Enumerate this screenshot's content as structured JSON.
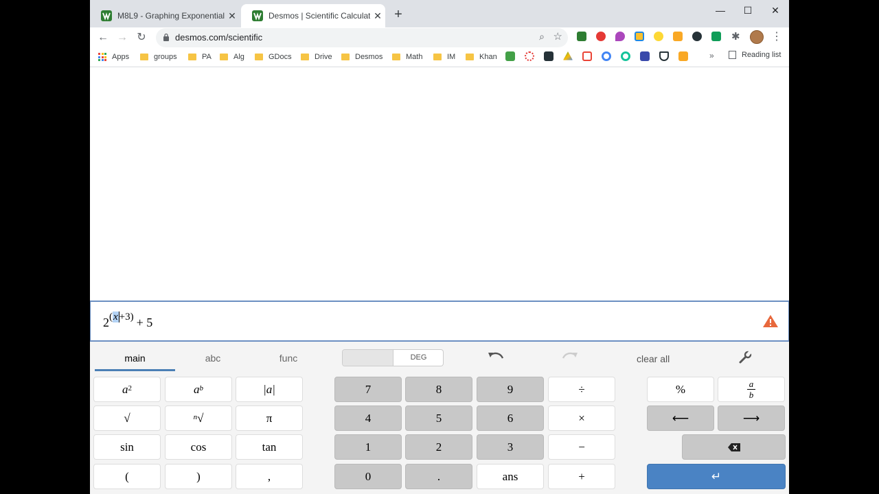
{
  "browser": {
    "tabs": [
      {
        "title": "M8L9 - Graphing Exponential Fu",
        "active": false
      },
      {
        "title": "Desmos | Scientific Calculator",
        "active": true
      }
    ],
    "new_tab": "+",
    "window_controls": {
      "minimize": "—",
      "maximize": "☐",
      "close": "✕"
    },
    "url": "desmos.com/scientific",
    "bookmarks": [
      "Apps",
      "groups",
      "PA",
      "Alg",
      "GDocs",
      "Drive",
      "Desmos",
      "Math",
      "IM",
      "Khan"
    ],
    "bookmarks_overflow": "»",
    "reading_list": "Reading list"
  },
  "calculator": {
    "expression": {
      "base": "2",
      "exp_open": "(",
      "exp_var": "x",
      "exp_rest": "+3)",
      "rest": "+ 5"
    },
    "keypad_tabs": [
      "main",
      "abc",
      "func"
    ],
    "angle_mode": "DEG",
    "clear_all": "clear all",
    "keys": {
      "sqrt": "√",
      "abs": "|a|",
      "pi": "π",
      "sin": "sin",
      "cos": "cos",
      "tan": "tan",
      "lparen": "(",
      "rparen": ")",
      "comma": ",",
      "n7": "7",
      "n8": "8",
      "n9": "9",
      "div": "÷",
      "n4": "4",
      "n5": "5",
      "n6": "6",
      "mul": "×",
      "n1": "1",
      "n2": "2",
      "n3": "3",
      "minus": "−",
      "n0": "0",
      "dot": ".",
      "ans": "ans",
      "plus": "+",
      "percent": "%",
      "left": "⟵",
      "right": "⟶",
      "backspace": "⌫",
      "enter": "↵"
    }
  }
}
